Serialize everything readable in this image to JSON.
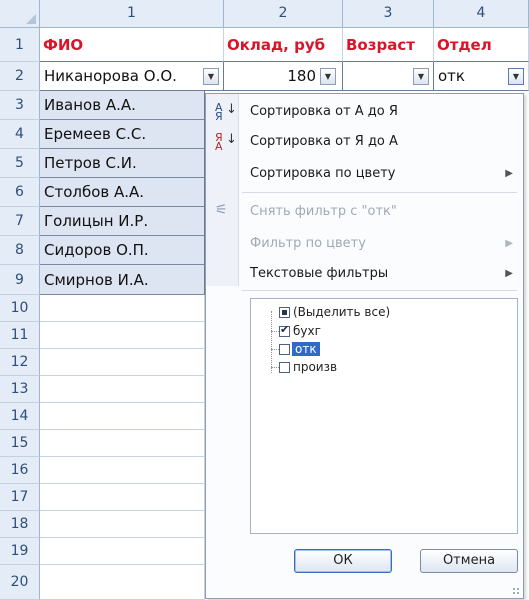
{
  "columns": [
    "1",
    "2",
    "3",
    "4"
  ],
  "rows": [
    "1",
    "2",
    "3",
    "4",
    "5",
    "6",
    "7",
    "8",
    "9",
    "10",
    "11",
    "12",
    "13",
    "14",
    "15",
    "16",
    "17",
    "18",
    "19",
    "20"
  ],
  "header_row": {
    "fio": "ФИО",
    "salary": "Оклад, руб",
    "age": "Возраст",
    "dept": "Отдел"
  },
  "filter_row": {
    "name": "Никанорова О.О.",
    "salary": "180",
    "age": "",
    "dept": "отк"
  },
  "names": [
    "Иванов А.А.",
    "Еремеев С.С.",
    "Петров С.И.",
    "Столбов А.А.",
    "Голицын И.Р.",
    "Сидоров О.П.",
    "Смирнов И.А."
  ],
  "menu": {
    "sort_az": "Сортировка от А до Я",
    "sort_za": "Сортировка от Я до А",
    "sort_color": "Сортировка по цвету",
    "clear_filter": "Снять фильтр с \"отк\"",
    "filter_color": "Фильтр по цвету",
    "text_filters": "Текстовые фильтры"
  },
  "filter_list": [
    {
      "label": "(Выделить все)",
      "state": "partial"
    },
    {
      "label": "бухг",
      "state": "checked"
    },
    {
      "label": "отк",
      "state": "unchecked"
    },
    {
      "label": "произв",
      "state": "unchecked"
    }
  ],
  "buttons": {
    "ok": "ОК",
    "cancel": "Отмена"
  },
  "colors": {
    "header_text": "#d8152a",
    "table_fill": "#dde4f2",
    "selection": "#316ac5",
    "sheet_header": "#e4ecf7"
  },
  "icons": {
    "sort_az": "sort-az-icon",
    "sort_za": "sort-za-icon",
    "clear_filter": "funnel-clear-icon",
    "dropdown": "chevron-down-icon",
    "submenu": "triangle-right-icon"
  }
}
